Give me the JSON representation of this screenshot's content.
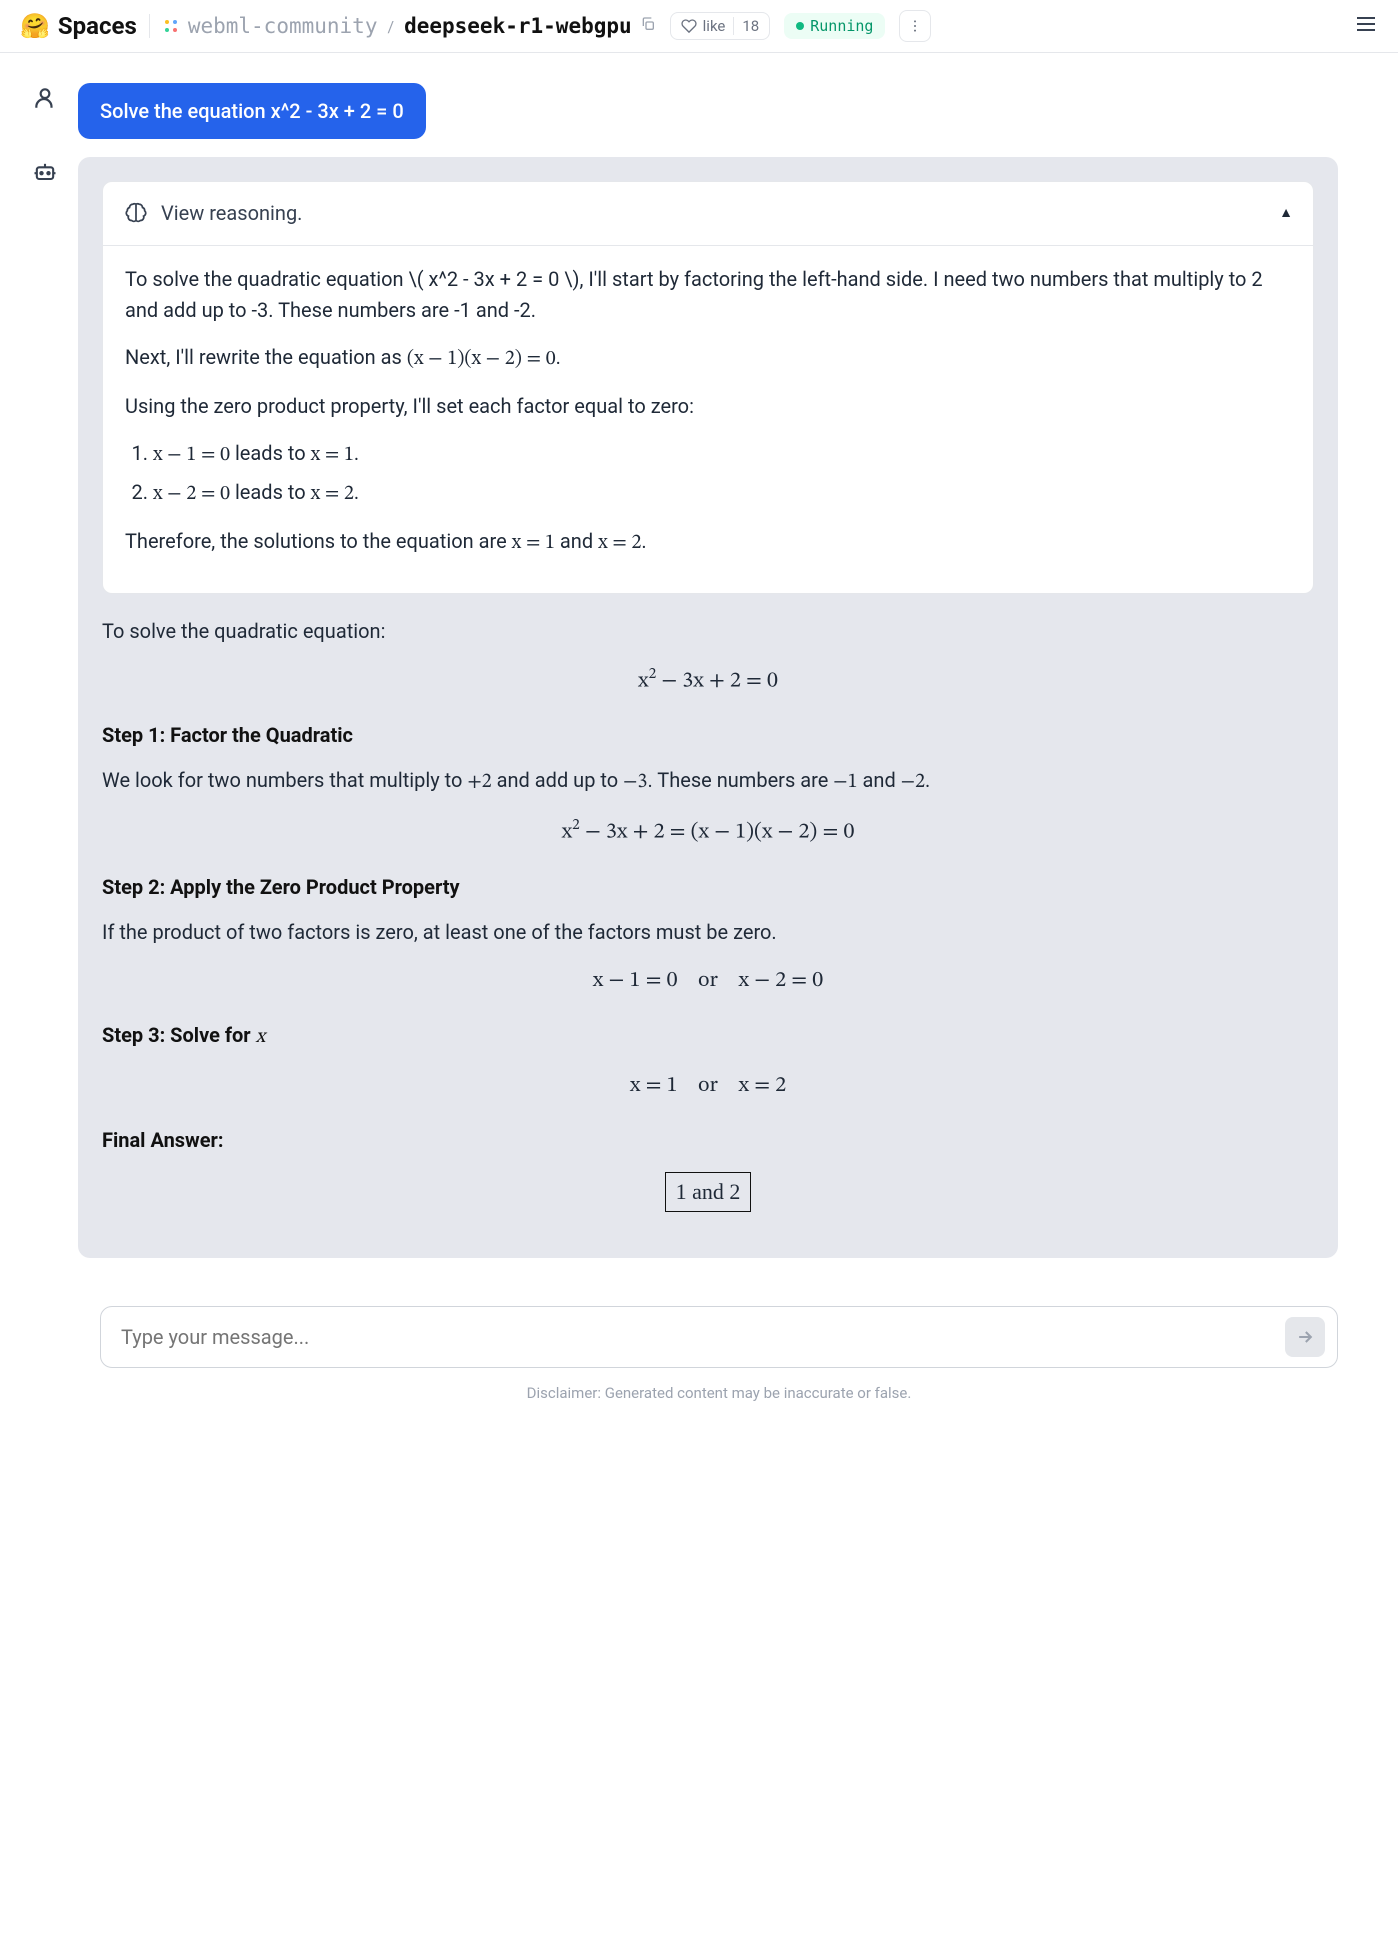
{
  "header": {
    "spaces_label": "Spaces",
    "org": "webml-community",
    "repo": "deepseek-r1-webgpu",
    "like_label": "like",
    "like_count": "18",
    "status": "Running"
  },
  "chat": {
    "user_message": "Solve the equation x^2 - 3x + 2 = 0",
    "reasoning_label": "View reasoning.",
    "reasoning": {
      "p1": "To solve the quadratic equation \\( x^2 - 3x + 2 = 0 \\), I'll start by factoring the left-hand side. I need two numbers that multiply to 2 and add up to -3. These numbers are -1 and -2.",
      "p2_prefix": "Next, I'll rewrite the equation as ",
      "p2_math": "(x − 1)(x − 2) = 0",
      "p2_suffix": ".",
      "p3": "Using the zero product property, I'll set each factor equal to zero:",
      "li1_math": "x − 1 = 0",
      "li1_mid": " leads to ",
      "li1_math2": "x = 1",
      "li2_math": "x − 2 = 0",
      "li2_mid": " leads to ",
      "li2_math2": "x = 2",
      "p4_prefix": "Therefore, the solutions to the equation are ",
      "p4_math1": "x = 1",
      "p4_mid": " and ",
      "p4_math2": "x = 2",
      "p4_suffix": "."
    },
    "answer": {
      "intro": "To solve the quadratic equation:",
      "eq1_a": "x",
      "eq1_b": " − 3x + 2 = 0",
      "step1_title": "Step 1: Factor the Quadratic",
      "step1_p_a": "We look for two numbers that multiply to ",
      "step1_p_m1": "+2",
      "step1_p_b": " and add up to ",
      "step1_p_m2": "−3",
      "step1_p_c": ". These numbers are ",
      "step1_p_m3": "−1",
      "step1_p_d": " and ",
      "step1_p_m4": "−2",
      "step1_p_e": ".",
      "eq2_a": "x",
      "eq2_b": " − 3x + 2 = (x − 1)(x − 2) = 0",
      "step2_title": "Step 2: Apply the Zero Product Property",
      "step2_p": "If the product of two factors is zero, at least one of the factors must be zero.",
      "eq3": "x − 1 = 0    or    x − 2 = 0",
      "step3_title_a": "Step 3: Solve for ",
      "step3_title_b": "x",
      "eq4": "x = 1    or    x = 2",
      "final_title": "Final Answer:",
      "boxed": "1 and 2"
    }
  },
  "input": {
    "placeholder": "Type your message..."
  },
  "disclaimer": "Disclaimer: Generated content may be inaccurate or false."
}
